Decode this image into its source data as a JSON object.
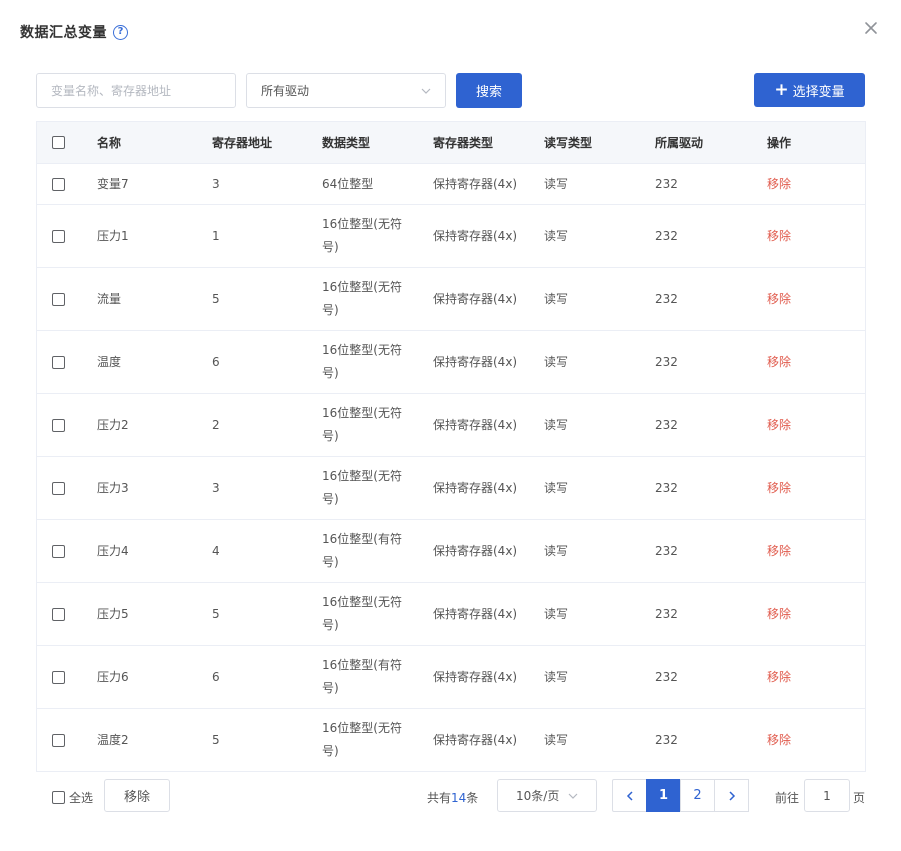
{
  "dialog": {
    "title": "数据汇总变量",
    "help_icon": "?"
  },
  "toolbar": {
    "search_placeholder": "变量名称、寄存器地址",
    "driver_select_value": "所有驱动",
    "search_button": "搜索",
    "select_variable_plus": "+",
    "select_variable_button": "选择变量"
  },
  "table": {
    "headers": [
      "名称",
      "寄存器地址",
      "数据类型",
      "寄存器类型",
      "读写类型",
      "所属驱动",
      "操作"
    ],
    "rows": [
      {
        "name": "变量7",
        "address": "3",
        "data_type": "64位整型",
        "data_type_cont": "",
        "register_type": "保持寄存器(4x)",
        "rw": "读写",
        "driver": "232",
        "action": "移除"
      },
      {
        "name": "压力1",
        "address": "1",
        "data_type": "16位整型(无符",
        "data_type_cont": "号)",
        "register_type": "保持寄存器(4x)",
        "rw": "读写",
        "driver": "232",
        "action": "移除"
      },
      {
        "name": "流量",
        "address": "5",
        "data_type": "16位整型(无符",
        "data_type_cont": "号)",
        "register_type": "保持寄存器(4x)",
        "rw": "读写",
        "driver": "232",
        "action": "移除"
      },
      {
        "name": "温度",
        "address": "6",
        "data_type": "16位整型(无符",
        "data_type_cont": "号)",
        "register_type": "保持寄存器(4x)",
        "rw": "读写",
        "driver": "232",
        "action": "移除"
      },
      {
        "name": "压力2",
        "address": "2",
        "data_type": "16位整型(无符",
        "data_type_cont": "号)",
        "register_type": "保持寄存器(4x)",
        "rw": "读写",
        "driver": "232",
        "action": "移除"
      },
      {
        "name": "压力3",
        "address": "3",
        "data_type": "16位整型(无符",
        "data_type_cont": "号)",
        "register_type": "保持寄存器(4x)",
        "rw": "读写",
        "driver": "232",
        "action": "移除"
      },
      {
        "name": "压力4",
        "address": "4",
        "data_type": "16位整型(有符",
        "data_type_cont": "号)",
        "register_type": "保持寄存器(4x)",
        "rw": "读写",
        "driver": "232",
        "action": "移除"
      },
      {
        "name": "压力5",
        "address": "5",
        "data_type": "16位整型(无符",
        "data_type_cont": "号)",
        "register_type": "保持寄存器(4x)",
        "rw": "读写",
        "driver": "232",
        "action": "移除"
      },
      {
        "name": "压力6",
        "address": "6",
        "data_type": "16位整型(有符",
        "data_type_cont": "号)",
        "register_type": "保持寄存器(4x)",
        "rw": "读写",
        "driver": "232",
        "action": "移除"
      },
      {
        "name": "温度2",
        "address": "5",
        "data_type": "16位整型(无符",
        "data_type_cont": "号)",
        "register_type": "保持寄存器(4x)",
        "rw": "读写",
        "driver": "232",
        "action": "移除"
      }
    ]
  },
  "footer": {
    "select_all_label": "全选",
    "bulk_remove_button": "移除",
    "total_prefix": "共有",
    "total_count": "14",
    "total_suffix": "条",
    "page_size": "10条/页",
    "pages": [
      "1",
      "2"
    ],
    "current_page": "1",
    "goto_prefix": "前往",
    "goto_value": "1",
    "goto_suffix": "页"
  },
  "colors": {
    "primary": "#2f63d1",
    "danger": "#e05a4c",
    "header_bg": "#f5f7fa",
    "border": "#ebeef5"
  }
}
